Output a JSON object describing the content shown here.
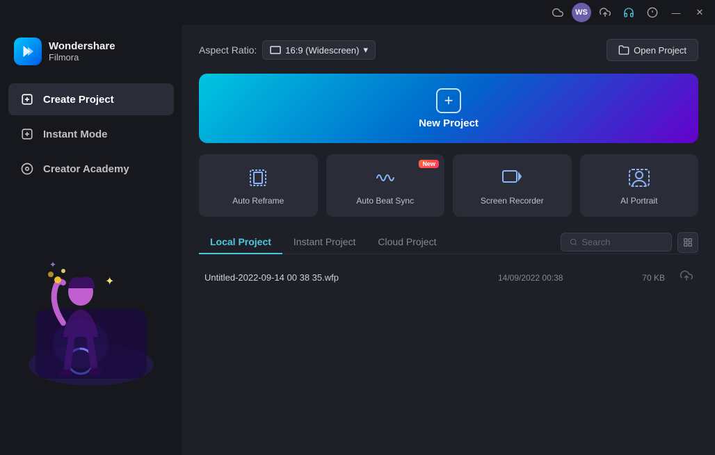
{
  "titlebar": {
    "icons": [
      {
        "name": "cloud-icon",
        "symbol": "☁"
      },
      {
        "name": "user-avatar-icon",
        "symbol": "👤"
      },
      {
        "name": "download-icon",
        "symbol": "⬆"
      },
      {
        "name": "headphone-icon",
        "symbol": "🎧"
      },
      {
        "name": "info-icon",
        "symbol": "ℹ"
      },
      {
        "name": "minimize-btn",
        "symbol": "—"
      },
      {
        "name": "close-btn",
        "symbol": "✕"
      }
    ]
  },
  "sidebar": {
    "logo": {
      "title": "Wondershare",
      "subtitle": "Filmora"
    },
    "nav": [
      {
        "id": "create-project",
        "label": "Create Project",
        "icon": "⊞",
        "active": true
      },
      {
        "id": "instant-mode",
        "label": "Instant Mode",
        "icon": "⊞",
        "active": false
      },
      {
        "id": "creator-academy",
        "label": "Creator Academy",
        "icon": "◎",
        "active": false
      }
    ]
  },
  "header": {
    "aspect_ratio_label": "Aspect Ratio:",
    "aspect_ratio_icon": "▭",
    "aspect_ratio_value": "16:9 (Widescreen)",
    "open_project_label": "Open Project"
  },
  "new_project": {
    "label": "New Project"
  },
  "tools": [
    {
      "id": "auto-reframe",
      "label": "Auto Reframe",
      "icon": "⬡",
      "badge": null
    },
    {
      "id": "auto-beat-sync",
      "label": "Auto Beat Sync",
      "icon": "〜",
      "badge": "New"
    },
    {
      "id": "screen-recorder",
      "label": "Screen Recorder",
      "icon": "▷",
      "badge": null
    },
    {
      "id": "ai-portrait",
      "label": "AI Portrait",
      "icon": "⊙",
      "badge": null
    }
  ],
  "project_tabs": [
    {
      "id": "local",
      "label": "Local Project",
      "active": true
    },
    {
      "id": "instant",
      "label": "Instant Project",
      "active": false
    },
    {
      "id": "cloud",
      "label": "Cloud Project",
      "active": false
    }
  ],
  "search": {
    "placeholder": "Search"
  },
  "projects": [
    {
      "name": "Untitled-2022-09-14 00 38 35.wfp",
      "date": "14/09/2022 00:38",
      "size": "70 KB"
    }
  ]
}
